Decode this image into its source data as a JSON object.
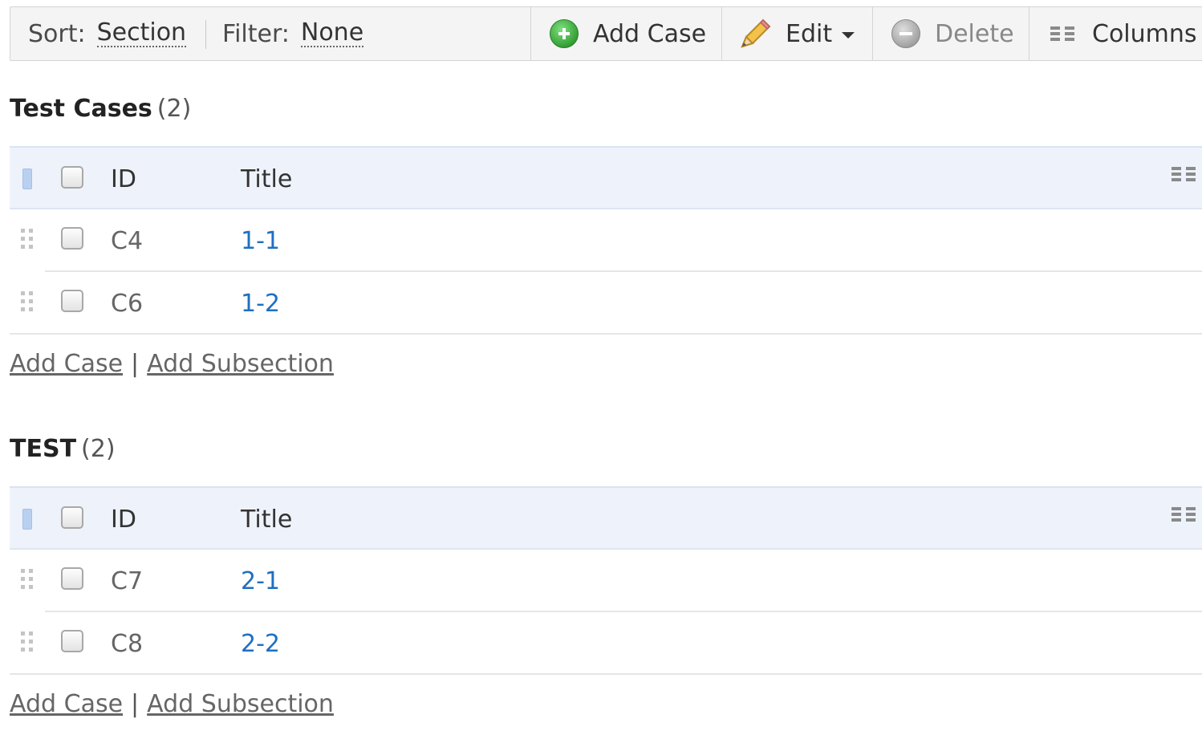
{
  "toolbar": {
    "sort_label": "Sort:",
    "sort_value": "Section",
    "filter_label": "Filter:",
    "filter_value": "None",
    "add_case": "Add Case",
    "edit": "Edit",
    "delete": "Delete",
    "columns": "Columns",
    "icons": {
      "add": "plus-circle-icon",
      "edit": "pencil-icon",
      "delete": "minus-circle-icon",
      "columns": "columns-icon"
    }
  },
  "table_header": {
    "id": "ID",
    "title": "Title"
  },
  "sections": [
    {
      "name": "Test Cases",
      "count": "(2)",
      "rows": [
        {
          "id": "C4",
          "title": "1-1"
        },
        {
          "id": "C6",
          "title": "1-2"
        }
      ],
      "add_case": "Add Case",
      "separator": "|",
      "add_subsection": "Add Subsection"
    },
    {
      "name": "TEST",
      "count": "(2)",
      "rows": [
        {
          "id": "C7",
          "title": "2-1"
        },
        {
          "id": "C8",
          "title": "2-2"
        }
      ],
      "add_case": "Add Case",
      "separator": "|",
      "add_subsection": "Add Subsection"
    }
  ],
  "colors": {
    "link": "#1f6fc0",
    "header_bg": "#eef3fb",
    "add_green": "#2f9a2f"
  }
}
